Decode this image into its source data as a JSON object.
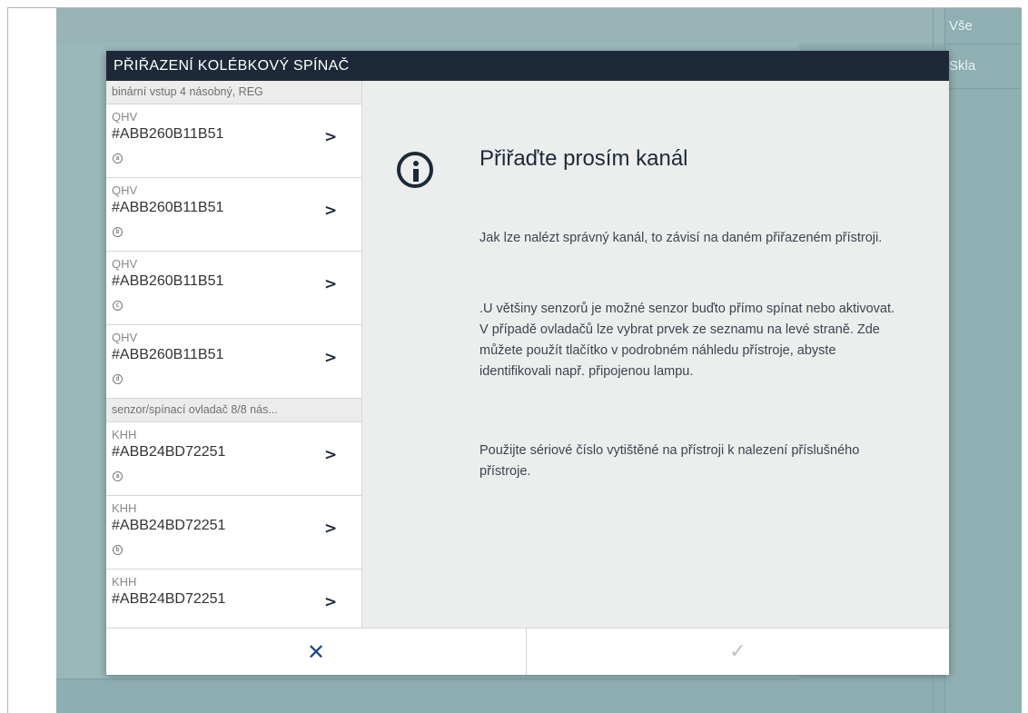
{
  "background": {
    "right_menu": [
      "Vše",
      "Skla"
    ]
  },
  "dialog": {
    "title": "PŘIŘAZENÍ KOLÉBKOVÝ SPÍNAČ",
    "groups": [
      {
        "header": "binární vstup 4 násobný, REG",
        "items": [
          {
            "type": "QHV",
            "serial": "#ABB260B11B51",
            "channel": "a"
          },
          {
            "type": "QHV",
            "serial": "#ABB260B11B51",
            "channel": "b"
          },
          {
            "type": "QHV",
            "serial": "#ABB260B11B51",
            "channel": "c"
          },
          {
            "type": "QHV",
            "serial": "#ABB260B11B51",
            "channel": "d"
          }
        ]
      },
      {
        "header": "senzor/spínací ovladač 8/8 nás...",
        "items": [
          {
            "type": "KHH",
            "serial": "#ABB24BD72251",
            "channel": "a"
          },
          {
            "type": "KHH",
            "serial": "#ABB24BD72251",
            "channel": "b"
          },
          {
            "type": "KHH",
            "serial": "#ABB24BD72251",
            "channel": ""
          }
        ]
      }
    ],
    "item_arrow": ">",
    "content": {
      "heading": "Přiřaďte prosím kanál",
      "paragraph1": "Jak lze nalézt správný kanál, to závisí na daném přiřazeném přístroji.",
      "paragraph2": ".U většiny senzorů je možné senzor buďto přímo spínat nebo aktivovat. V případě ovladačů lze vybrat prvek ze seznamu na levé straně. Zde můžete použít tlačítko v podrobném náhledu přístroje, abyste identifikovali např. připojenou lampu.",
      "paragraph3": "Použijte sériové číslo vytištěné na přístroji k nalezení příslušného přístroje."
    },
    "footer": {
      "cancel_symbol": "✕",
      "confirm_symbol": "✓"
    }
  },
  "colors": {
    "header_bg": "#1d2938",
    "cancel_icon": "#1e4a8a",
    "confirm_disabled": "#c2c2c2",
    "app_bg": "#8eaeb1"
  }
}
